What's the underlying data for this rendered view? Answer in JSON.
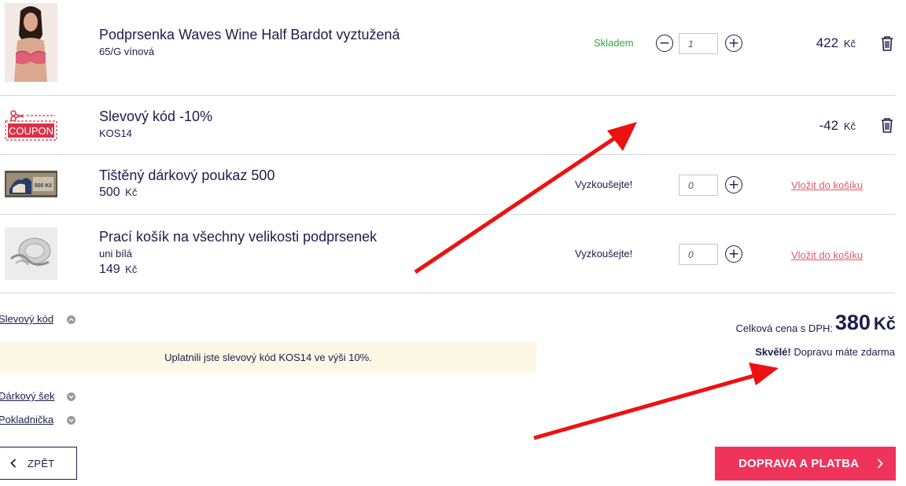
{
  "items": [
    {
      "name": "Podprsenka Waves Wine Half Bardot vyztužená",
      "variant": "65/G vínová",
      "stock": "Skladem",
      "quantity": "1",
      "price": "422",
      "currency": "Kč"
    },
    {
      "name": "Slevový kód -10%",
      "code": "KOS14",
      "coupon_label": "COUPON",
      "price": "-42",
      "currency": "Kč"
    }
  ],
  "recommendations": [
    {
      "name": "Tištěný dárkový poukaz 500",
      "unit_price": "500",
      "currency": "Kč",
      "badge": "Vyzkoušejte!",
      "quantity": "0",
      "add_label": "Vložit do košíku",
      "voucher_text": "500 Kč"
    },
    {
      "name": "Prací košík na všechny velikosti podprsenek",
      "variant": "uni bílá",
      "unit_price": "149",
      "currency": "Kč",
      "badge": "Vyzkoušejte!",
      "quantity": "0",
      "add_label": "Vložit do košíku"
    }
  ],
  "discount": {
    "toggle_label": "Slevový kód",
    "notice": "Uplatnili jste slevový kód KOS14 ve výši 10%."
  },
  "gift_check": {
    "toggle_label": "Dárkový šek"
  },
  "piggy_bank": {
    "toggle_label": "Pokladnička"
  },
  "summary": {
    "total_label": "Celková cena s DPH:",
    "total_value": "380",
    "currency": "Kč",
    "shipping_strong": "Skvělé!",
    "shipping_text": "Dopravu máte zdarma"
  },
  "buttons": {
    "back_label": "ZPĚT",
    "checkout_label": "DOPRAVA A PLATBA"
  },
  "colors": {
    "text": "#1b1e4b",
    "accent": "#f0335b",
    "link": "#e05a6e",
    "stock": "#3aa34a",
    "notice_bg": "#fdf8e6",
    "annotation": "#ee1111"
  }
}
